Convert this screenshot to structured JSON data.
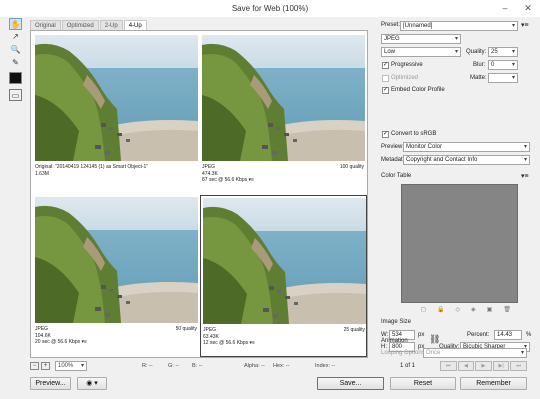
{
  "window": {
    "title": "Save for Web (100%)"
  },
  "tabs": [
    "Original",
    "Optimized",
    "2-Up",
    "4-Up"
  ],
  "active_tab": 3,
  "tools": [
    "hand-icon",
    "slice-select-icon",
    "zoom-icon",
    "eyedropper-icon",
    "eyedropper-color-icon",
    "toggle-slices-icon"
  ],
  "panes": [
    {
      "left": "Original: \"20140419 124145 (1) as Smart Object-1\"",
      "left2": "1.63M",
      "left3": "",
      "right": ""
    },
    {
      "left": "JPEG",
      "left2": "474.3K",
      "left3": "87 sec @ 56.6 Kbps",
      "right": "100 quality"
    },
    {
      "left": "JPEG",
      "left2": "104.6K",
      "left3": "20 sec @ 56.6 Kbps",
      "right": "50 quality"
    },
    {
      "left": "JPEG",
      "left2": "63.43K",
      "left3": "12 sec @ 56.6 Kbps",
      "right": "25 quality"
    }
  ],
  "status": {
    "zoom": "100%",
    "r": "R: --",
    "g": "G: --",
    "b": "B: --",
    "alpha": "Alpha: --",
    "hex": "Hex: --",
    "index": "Index: --"
  },
  "buttons": {
    "preview": "Preview...",
    "save": "Save...",
    "reset": "Reset",
    "remember": "Remember"
  },
  "settings": {
    "preset_label": "Preset:",
    "preset_value": "[Unnamed]",
    "format": "JPEG",
    "quality_level": "Low",
    "quality_label": "Quality:",
    "quality_value": "25",
    "progressive": "Progressive",
    "blur_label": "Blur:",
    "blur_value": "0",
    "optimized": "Optimized",
    "matte_label": "Matte:",
    "embed_profile": "Embed Color Profile",
    "convert_srgb": "Convert to sRGB",
    "preview_label": "Preview:",
    "preview_value": "Monitor Color",
    "metadata_label": "Metadata:",
    "metadata_value": "Copyright and Contact Info",
    "color_table": "Color Table",
    "image_size": "Image Size",
    "w_label": "W:",
    "w_value": "534",
    "h_label": "H:",
    "h_value": "800",
    "px": "px",
    "percent_label": "Percent:",
    "percent_value": "14.43",
    "percent_unit": "%",
    "resample_label": "Quality:",
    "resample_value": "Bicubic Sharper",
    "animation": "Animation",
    "looping_label": "Looping Options:",
    "looping_value": "Once",
    "frame_counter": "1 of 1"
  }
}
